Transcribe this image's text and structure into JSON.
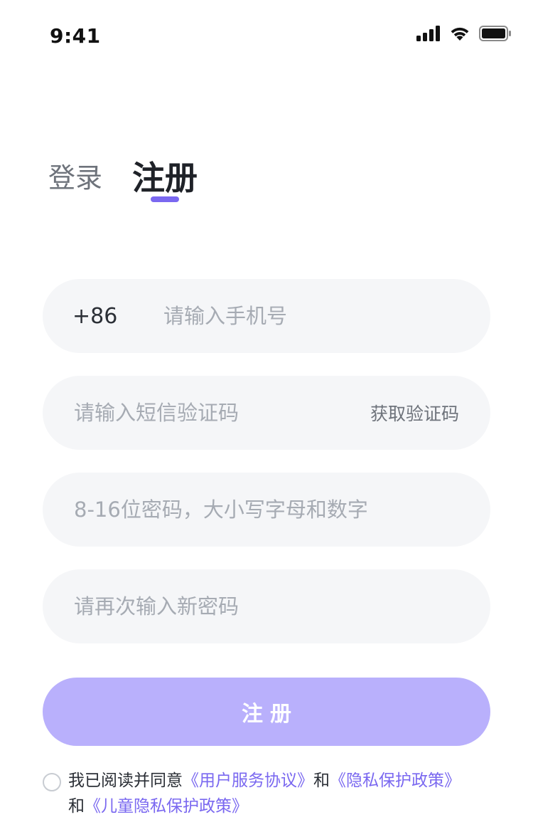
{
  "status_bar": {
    "time": "9:41",
    "icons": [
      "cellular-signal-icon",
      "wifi-icon",
      "battery-icon"
    ]
  },
  "tabs": {
    "login_label": "登录",
    "register_label": "注册",
    "active": "register"
  },
  "form": {
    "phone": {
      "country_code": "+86",
      "placeholder": "请输入手机号"
    },
    "sms": {
      "placeholder": "请输入短信验证码",
      "get_code_label": "获取验证码"
    },
    "password": {
      "placeholder": "8-16位密码，大小写字母和数字"
    },
    "confirm_password": {
      "placeholder": "请再次输入新密码"
    },
    "submit_label": "注册"
  },
  "agreement": {
    "prefix": "我已阅读并同意",
    "user_agreement": "《用户服务协议》",
    "and_1": "和",
    "privacy_policy": "《隐私保护政策》",
    "and_2": "和",
    "child_privacy_policy": "《儿童隐私保护政策》",
    "checked": false
  },
  "colors": {
    "accent": "#7a68f0",
    "button_disabled": "#b9b0fc",
    "field_bg": "#f5f6f8",
    "placeholder": "#a6abb3"
  }
}
